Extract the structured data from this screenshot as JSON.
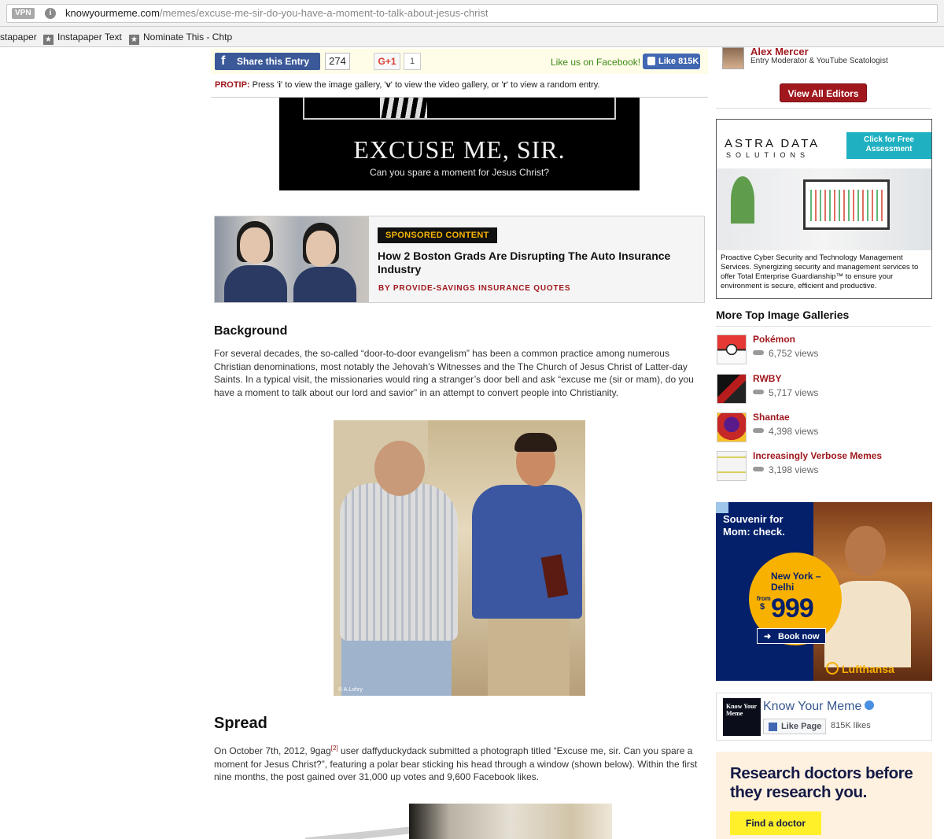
{
  "browser": {
    "vpn_label": "VPN",
    "url_domain": "knowyourmeme.com",
    "url_path": "/memes/excuse-me-sir-do-you-have-a-moment-to-talk-about-jesus-christ",
    "bookmarks": [
      {
        "label": "stapaper"
      },
      {
        "label": "Instapaper Text"
      },
      {
        "label": "Nominate This - Chtp"
      }
    ]
  },
  "share_bar": {
    "share_label": "Share this Entry",
    "share_count": "274",
    "gplus_label": "G+1",
    "gplus_count": "1",
    "like_us_text": "Like us on Facebook!",
    "like_label": "Like 815K"
  },
  "protip": {
    "label": "PROTIP:",
    "text_before_i": " Press '",
    "key_i": "i",
    "text_after_i": "' to view the image gallery, '",
    "key_v": "v",
    "text_after_v": "' to view the video gallery, or '",
    "key_r": "r",
    "text_after_r": "' to view a random entry."
  },
  "meme_image": {
    "title": "EXCUSE ME, SIR.",
    "subtitle": "Can you spare a moment for Jesus Christ?"
  },
  "sponsored": {
    "badge": "SPONSORED CONTENT",
    "title": "How 2 Boston Grads Are Disrupting The Auto Insurance Industry",
    "byline": "BY PROVIDE-SAVINGS INSURANCE QUOTES"
  },
  "background": {
    "heading": "Background",
    "paragraph": "For several decades, the so-called “door-to-door evangelism” has been a common practice among numerous Christian denominations, most notably the Jehovah’s Witnesses and the The Church of Jesus Christ of Latter-day Saints. In a typical visit, the missionaries would ring a stranger’s door bell and ask “excuse me (sir or mam), do you have a moment to talk about our lord and savior” in an attempt to convert people into Christianity.",
    "photo_credit": "© A.Lohry"
  },
  "spread": {
    "heading": "Spread",
    "text_before_ref": "On October 7th, 2012, 9gag",
    "ref": "[2]",
    "text_after_ref": " user daffyduckydack submitted a photograph titled “Excuse me, sir. Can you spare a moment for Jesus Christ?”, featuring a polar bear sticking his head through a window (shown below). Within the first nine months, the post gained over 31,000 up votes and 9,600 Facebook likes."
  },
  "sidebar": {
    "editor_name": "Alex Mercer",
    "editor_role": "Entry Moderator & YouTube Scatologist",
    "view_all_editors": "View All Editors",
    "astra_ad": {
      "logo_line1": "ASTRA DATA",
      "logo_line2": "SOLUTIONS",
      "cta": "Click for Free Assessment",
      "text": "Proactive Cyber Security and Technology Management Services. Synergizing security and management services to offer Total Enterprise Guardianship™ to ensure your environment is secure, efficient and productive."
    },
    "galleries_title": "More Top Image Galleries",
    "galleries": [
      {
        "title": "Pokémon",
        "views": "6,752 views",
        "color": "#e53935"
      },
      {
        "title": "RWBY",
        "views": "5,717 views",
        "color": "#222222"
      },
      {
        "title": "Shantae",
        "views": "4,398 views",
        "color": "#c62828"
      },
      {
        "title": "Increasingly Verbose Memes",
        "views": "3,198 views",
        "color": "#f0f0f0"
      }
    ],
    "lufthansa_ad": {
      "headline": "Souvenir for Mom: check.",
      "route": "New York – Delhi",
      "from": "from",
      "currency": "$",
      "price": "999",
      "book": "Book now",
      "brand": "Lufthansa"
    },
    "kym_box": {
      "logo_text": "Know Your Meme",
      "name": "Know Your Meme",
      "like_page": "Like Page",
      "likes": "815K likes"
    },
    "zocdoc_ad": {
      "headline": "Research doctors before they research you.",
      "button": "Find a doctor"
    }
  }
}
